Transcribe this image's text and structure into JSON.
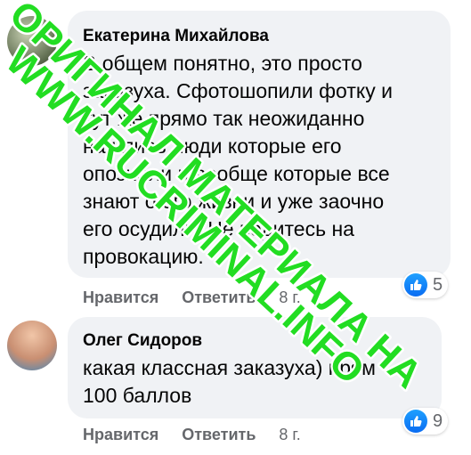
{
  "comments": [
    {
      "author": "Екатерина Михайлова",
      "lines": [
        "В общем понятно, это просто",
        "заказуха. Сфотошопили фотку и",
        "тут же прямо так неожиданно",
        "нашлись люди которые его",
        "опознали и вообще которые все",
        "знают о его жизни и уже заочно",
        "его осудили. Не ведитесь на",
        "провокацию."
      ],
      "reaction_icon": "like-icon",
      "reaction_count": "5",
      "like_label": "Нравится",
      "reply_label": "Ответить",
      "time": "8 г."
    },
    {
      "author": "Олег Сидоров",
      "lines": [
        "какая классная заказуха) прям",
        "100 баллов"
      ],
      "reaction_icon": "like-icon",
      "reaction_count": "9",
      "like_label": "Нравится",
      "reply_label": "Ответить",
      "time": "8 г."
    }
  ],
  "watermark": {
    "line1": "ОРИГИНАЛ МАТЕРИАЛА НА",
    "line2": "WWW.RUCRIMINAL.INFO",
    "color": "#22dd22"
  },
  "colors": {
    "bubble": "#f0f2f5",
    "meta": "#65676b",
    "like": "#1877f2"
  }
}
